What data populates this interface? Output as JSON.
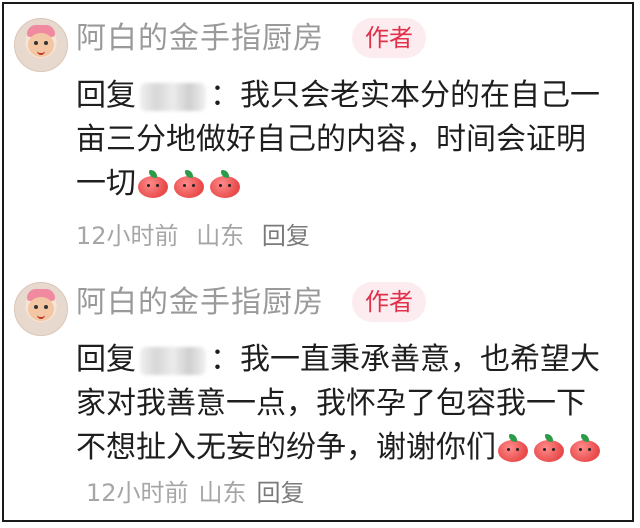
{
  "comments": [
    {
      "username": "阿白的金手指厨房",
      "badge": "作者",
      "reply_prefix": "回复",
      "reply_suffix": "：",
      "text": "我只会老实本分的在自己一亩三分地做好自己的内容，时间会证明一切",
      "emoji_count": 3,
      "time": "12小时前",
      "location": "山东",
      "reply_label": "回复"
    },
    {
      "username": "阿白的金手指厨房",
      "badge": "作者",
      "reply_prefix": "回复",
      "reply_suffix": "：",
      "text": "我一直秉承善意，也希望大家对我善意一点，我怀孕了包容我一下不想扯入无妄的纷争，谢谢你们",
      "emoji_count": 3,
      "time": "12小时前",
      "location": "山东",
      "reply_label": "回复"
    }
  ],
  "colors": {
    "badge_text": "#e0314b",
    "badge_bg": "#fdecef",
    "meta": "#a6a6a6",
    "username": "#9a9a9a"
  },
  "icons": {
    "emoji": "apple-face-emoji"
  }
}
